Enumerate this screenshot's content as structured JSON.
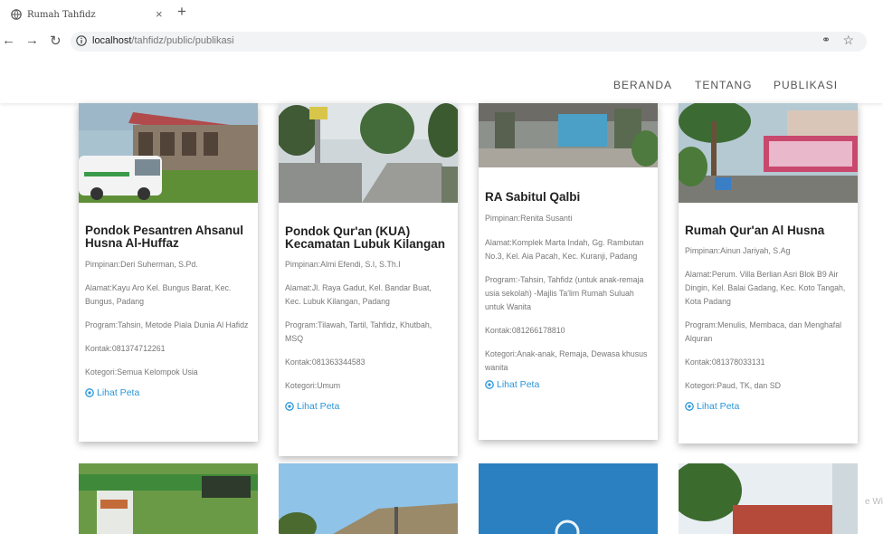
{
  "browser": {
    "tab_title": "Rumah Tahfidz",
    "tab_close": "×",
    "new_tab": "+",
    "url_host": "localhost",
    "url_path": "/tahfidz/public/publikasi",
    "icons": [
      "globe-icon",
      "back-icon",
      "forward-icon",
      "reload-icon",
      "info-icon",
      "key-icon",
      "star-icon"
    ]
  },
  "nav": {
    "items": [
      "BERANDA",
      "TENTANG",
      "PUBLIKASI"
    ]
  },
  "cards": [
    {
      "title": "Pondok Pesantren Ahsanul Husna Al-Huffaz",
      "pimpinan": "Pimpinan:Deri Suherman, S.Pd.",
      "alamat": "Alamat:Kayu Aro Kel. Bungus Barat, Kec. Bungus, Padang",
      "program": "Program:Tahsin, Metode Piala Dunia Al Hafidz",
      "kontak": "Kontak:081374712261",
      "kategori": "Kotegori:Semua Kelompok Usia",
      "link": "Lihat Peta"
    },
    {
      "title": "Pondok Qur'an (KUA) Kecamatan Lubuk Kilangan",
      "pimpinan": "Pimpinan:Almi Efendi, S.I, S.Th.I",
      "alamat": "Alamat:Jl. Raya Gadut, Kel. Bandar Buat, Kec. Lubuk Kilangan, Padang",
      "program": "Program:Tilawah, Tartil, Tahfidz, Khutbah, MSQ",
      "kontak": "Kontak:081363344583",
      "kategori": "Kotegori:Umum",
      "link": "Lihat Peta"
    },
    {
      "title": "RA Sabitul Qalbi",
      "pimpinan": "Pimpinan:Renita Susanti",
      "alamat": "Alamat:Komplek Marta Indah, Gg. Rambutan No.3, Kel. Aia Pacah, Kec. Kuranji, Padang",
      "program": "Program:-Tahsin, Tahfidz (untuk anak-remaja usia sekolah) -Majlis Ta'lim Rumah Suluah untuk Wanita",
      "kontak": "Kontak:081266178810",
      "kategori": "Kotegori:Anak-anak, Remaja, Dewasa khusus wanita",
      "link": "Lihat Peta"
    },
    {
      "title": "Rumah Qur'an Al Husna",
      "pimpinan": "Pimpinan:Ainun Jariyah, S.Ag",
      "alamat": "Alamat:Perum. Villa Berlian Asri Blok B9 Air Dingin, Kel. Balai Gadang, Kec. Koto Tangah, Kota Padang",
      "program": "Program:Menulis, Membaca, dan Menghafal Alquran",
      "kontak": "Kontak:081378033131",
      "kategori": "Kotegori:Paud, TK, dan SD",
      "link": "Lihat Peta"
    }
  ],
  "watermark": "e Wi",
  "colors": {
    "accent": "#2a96d8",
    "title": "#222222",
    "meta": "#777777"
  }
}
